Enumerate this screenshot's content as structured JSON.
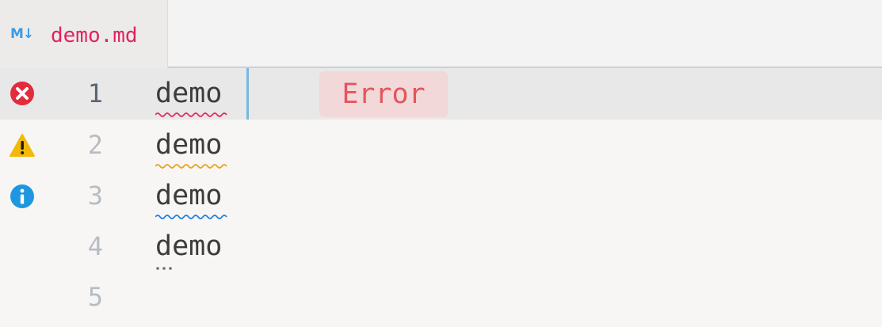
{
  "tab": {
    "icon": "markdown-icon",
    "icon_text": "M↓",
    "title": "demo.md",
    "title_color": "#e0245e"
  },
  "lines": [
    {
      "number": "1",
      "text": "demo",
      "diagnostic": "error",
      "icon": "error-icon"
    },
    {
      "number": "2",
      "text": "demo",
      "diagnostic": "warning",
      "icon": "warning-icon"
    },
    {
      "number": "3",
      "text": "demo",
      "diagnostic": "info",
      "icon": "info-icon"
    },
    {
      "number": "4",
      "text": "demo",
      "diagnostic": "hint"
    },
    {
      "number": "5",
      "text": ""
    }
  ],
  "inline_message": {
    "text": "Error",
    "color": "#e2565e",
    "background": "#f2d8d9"
  },
  "colors": {
    "error": "#e22b3b",
    "warning": "#f2b90c",
    "info": "#1f97e0",
    "hint": "#6d6d6d",
    "cursor": "#79b8dd"
  }
}
